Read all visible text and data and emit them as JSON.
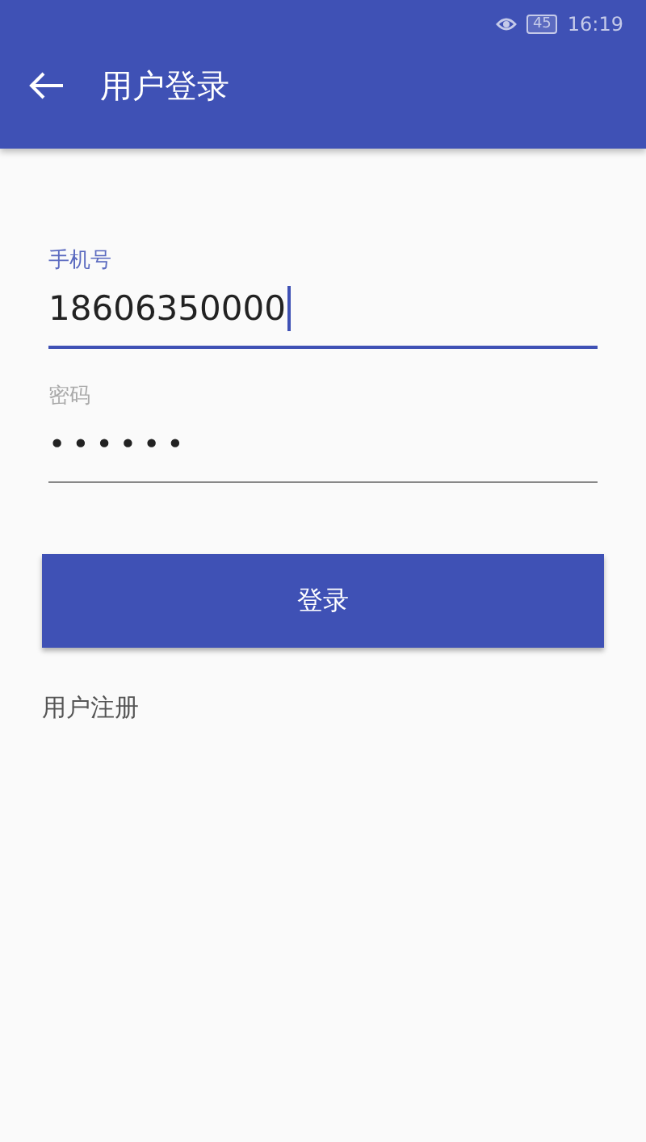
{
  "status_bar": {
    "battery": "45",
    "time": "16:19"
  },
  "app_bar": {
    "title": "用户登录"
  },
  "fields": [
    {
      "label": "手机号",
      "value": "18606350000",
      "focused": true
    },
    {
      "label": "密码",
      "value": "••••••",
      "focused": false
    }
  ],
  "login_button": "登录",
  "register_link": "用户注册"
}
